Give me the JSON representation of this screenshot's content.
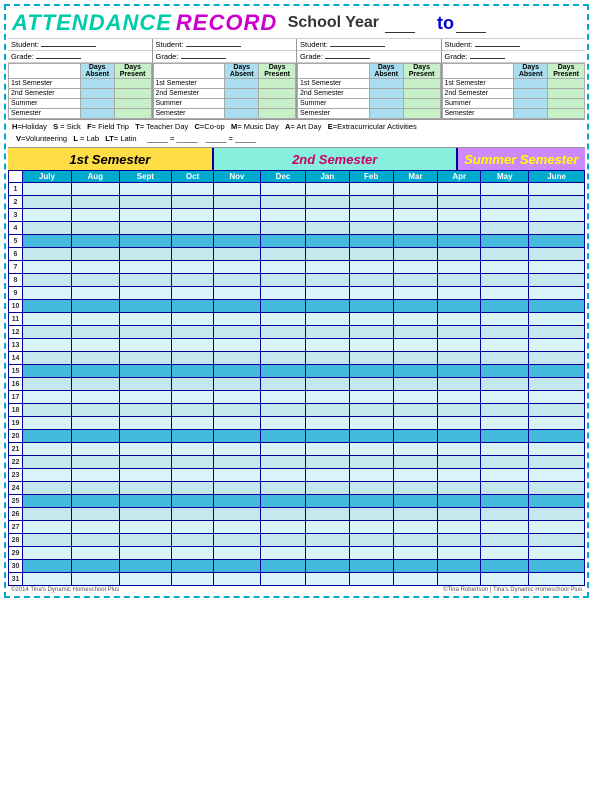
{
  "title": {
    "attendance": "ATTENDANCE",
    "record": "RECORD",
    "school": "School Year",
    "to": "to",
    "underline_left": "___",
    "underline_right": "___"
  },
  "students": [
    {
      "label": "Student:",
      "grade_label": "Grade:"
    },
    {
      "label": "Student:",
      "grade_label": "Grade:"
    },
    {
      "label": "Student:",
      "grade_label": "Grade:"
    },
    {
      "label": "Student:",
      "grade_label": "Grade:"
    }
  ],
  "summary": {
    "headers": [
      "Days Absent",
      "Days Present"
    ],
    "rows": [
      {
        "label": "1st Semester"
      },
      {
        "label": "2nd Semester"
      },
      {
        "label": "Summer"
      },
      {
        "label": "Semester"
      }
    ]
  },
  "legend": {
    "line1": "H=Holiday  S = Sick  F= Field Trip  T= Teacher Day  C=Co-op  M= Music Day  A= Art Day  E=Extracurricular Activities",
    "line2": "V=Volunteering  L = Lab  LT= Latin           =           ="
  },
  "semesters": {
    "first": "1st Semester",
    "second": "2nd Semester",
    "summer": "Summer Semester"
  },
  "months": [
    "July",
    "Aug",
    "Sept",
    "Oct",
    "Nov",
    "Dec",
    "Jan",
    "Feb",
    "Mar",
    "Apr",
    "May",
    "June"
  ],
  "days": [
    1,
    2,
    3,
    4,
    5,
    6,
    7,
    8,
    9,
    10,
    11,
    12,
    13,
    14,
    15,
    16,
    17,
    18,
    19,
    20,
    21,
    22,
    23,
    24,
    25,
    26,
    27,
    28,
    29,
    30,
    31
  ],
  "highlight_rows": [
    5,
    10,
    15,
    20,
    25,
    30
  ],
  "footer": {
    "left": "©2014 Tina's Dynamic Homeschool Plus",
    "right": "©Tina Robertson | Tina's Dynamic Homeschool Plus"
  }
}
